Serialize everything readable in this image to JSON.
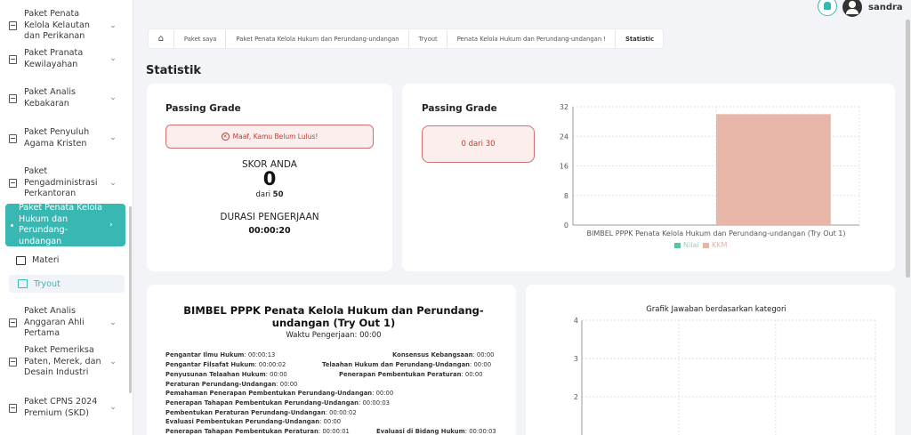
{
  "sidebar": {
    "items": [
      {
        "label": "Paket Penata Kelola Kelautan dan Perikanan"
      },
      {
        "label": "Paket Pranata Kewilayahan"
      },
      {
        "label": "Paket Analis Kebakaran"
      },
      {
        "label": "Paket Penyuluh Agama Kristen"
      },
      {
        "label": "Paket Pengadministrasi Perkantoran"
      },
      {
        "label": "Paket Penata Kelola Hukum dan Perundang-undangan"
      },
      {
        "label": "Paket Analis Anggaran Ahli Pertama"
      },
      {
        "label": "Paket Pemeriksa Paten, Merek, dan Desain Industri"
      },
      {
        "label": "Paket CPNS 2024 Premium (SKD)"
      }
    ],
    "sub": {
      "materi": "Materi",
      "tryout": "Tryout"
    },
    "chevron": "›",
    "chevron_down": "⌄"
  },
  "user": {
    "name": "sandra"
  },
  "breadcrumb": [
    "Paket saya",
    "Paket Penata Kelola Hukum dan Perundang-undangan",
    "Tryout",
    "Penata Kelola Hukum dan Perundang-undangan !",
    "Statistic"
  ],
  "page_title": "Statistik",
  "passing_card": {
    "heading": "Passing Grade",
    "fail_msg": "Maaf, Kamu Belum Lulus!",
    "score_label": "SKOR ANDA",
    "score": "0",
    "out_of_prefix": "dari",
    "out_of": "50",
    "duration_label": "DURASI PENGERJAAN",
    "duration": "00:00:20"
  },
  "grade_card": {
    "heading": "Passing Grade",
    "value": "0 dari 30"
  },
  "summary": {
    "title": "BIMBEL PPPK Penata Kelola Hukum dan Perundang-undangan (Try Out 1)",
    "time_label": "Waktu Pengerjaan: 00:00",
    "rows": [
      {
        "k": "Pengantar Ilmu Hukum",
        "v": "00:00:13"
      },
      {
        "k": "Konsensus Kebangsaan",
        "v": "00:00"
      },
      {
        "k": "Pengantar Filsafat Hukum",
        "v": "00:00:02"
      },
      {
        "k": "Telaahan Hukum dan Perundang-Undangan",
        "v": "00:00"
      },
      {
        "k": "Penyusunan Telaahan Hukum",
        "v": "00:00"
      },
      {
        "k": "Penerapan Pembentukan Peraturan",
        "v": "00:00"
      },
      {
        "k": "Peraturan Perundang-Undangan",
        "v": "00:00"
      },
      {
        "k": "Pemahaman Penerapan Pembentukan Perundang-Undangan",
        "v": "00:00"
      },
      {
        "k": "Penerapan Tahapan Pembentukan Perundang-Undangan",
        "v": "00:00:03"
      },
      {
        "k": "Pembentukan Peraturan Perundang-Undangan",
        "v": "00:00:02"
      },
      {
        "k": "Evaluasi Pembentukan Perundang-Undangan",
        "v": "00:00"
      },
      {
        "k": "Penerapan Tahapan Pembentukan Peraturan",
        "v": "00:00:01"
      },
      {
        "k": "Evaluasi di Bidang Hukum",
        "v": "00:00:03"
      }
    ]
  },
  "colors": {
    "accent": "#39b8b3",
    "kkm": "#e8b5a9",
    "nilai": "#5cc49a"
  },
  "chart_data": [
    {
      "type": "bar",
      "categories": [
        "BIMBEL PPPK Penata Kelola Hukum dan Perundang-undangan (Try Out 1)"
      ],
      "series": [
        {
          "name": "Nilai",
          "values": [
            0
          ]
        },
        {
          "name": "KKM",
          "values": [
            30
          ]
        }
      ],
      "yticks": [
        "0",
        "8",
        "16",
        "24",
        "32"
      ],
      "ylim": [
        0,
        32
      ],
      "legend": "bottom",
      "grid": true
    },
    {
      "type": "bar",
      "title": "Grafik Jawaban berdasarkan kategori",
      "yticks": [
        "4",
        "3",
        "2"
      ],
      "ylim": [
        1,
        4
      ],
      "grid": true
    }
  ]
}
